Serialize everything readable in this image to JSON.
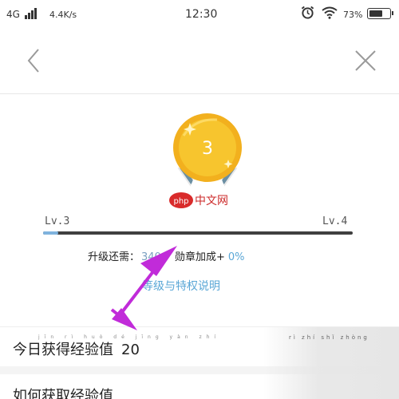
{
  "status_bar": {
    "network": "4G",
    "speed": "4.4K/s",
    "time": "12:30",
    "battery_pct": "73%",
    "battery_level": 0.73
  },
  "medal": {
    "level_number": "3"
  },
  "watermark": {
    "text": "php中文网"
  },
  "level": {
    "current_label": "Lv.3",
    "next_label": "Lv.4",
    "progress": 0.05
  },
  "upgrade": {
    "need_label": "升级还需：",
    "need_value": "340，",
    "bonus_label": "勋章加成+",
    "bonus_value": "0%"
  },
  "links": {
    "level_privilege": "等级与特权说明"
  },
  "today": {
    "label": "今日获得经验值",
    "value": "20",
    "pinyin": "jīn rì huò dé jīng yàn zhí",
    "pinyin_right": "rì zhí shǐ zhòng"
  },
  "next": {
    "label": "如何获取经验值"
  },
  "colors": {
    "accent": "#5aa7d6",
    "progress_fill": "#7fb3de",
    "gold": "#f2b01e",
    "arrow": "#c12bd9"
  }
}
